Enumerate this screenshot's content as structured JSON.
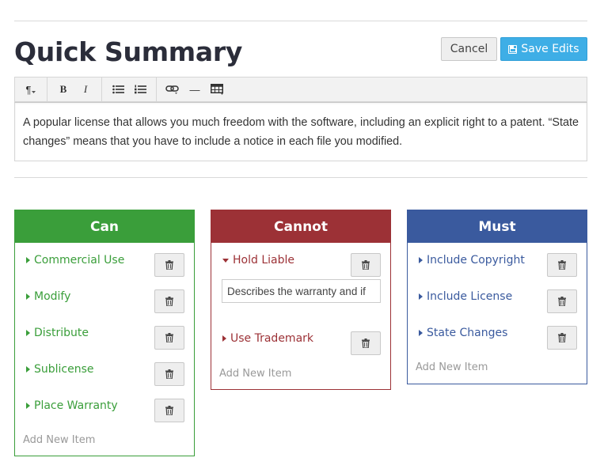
{
  "page": {
    "title": "Quick Summary",
    "cancel_label": "Cancel",
    "save_label": "Save Edits"
  },
  "toolbar": {
    "buttons": [
      {
        "name": "paragraph-format",
        "glyph": "¶"
      },
      {
        "name": "bold",
        "glyph": "B"
      },
      {
        "name": "italic",
        "glyph": "I"
      },
      {
        "name": "unordered-list",
        "icon": "bullet-list-icon"
      },
      {
        "name": "ordered-list",
        "icon": "numbered-list-icon"
      },
      {
        "name": "link",
        "icon": "link-icon"
      },
      {
        "name": "horizontal-rule",
        "glyph": "—"
      },
      {
        "name": "table",
        "icon": "table-icon"
      }
    ]
  },
  "editor": {
    "text": "A popular license that allows you much freedom with the software, including an explicit right to a patent. “State changes” means that you have to include a notice in each file you modified."
  },
  "columns": {
    "can": {
      "title": "Can",
      "color": "#3a9e3a",
      "items": [
        "Commercial Use",
        "Modify",
        "Distribute",
        "Sublicense",
        "Place Warranty"
      ],
      "add_label": "Add New Item"
    },
    "cannot": {
      "title": "Cannot",
      "color": "#9c3136",
      "items": [
        "Hold Liable",
        "Use Trademark"
      ],
      "expanded_item": "Hold Liable",
      "description_value": "Describes the warranty and if",
      "add_label": "Add New Item"
    },
    "must": {
      "title": "Must",
      "color": "#3a5a9e",
      "items": [
        "Include Copyright",
        "Include License",
        "State Changes"
      ],
      "add_label": "Add New Item"
    }
  },
  "colors": {
    "save_button": "#3eaee6",
    "title_text": "#2b2d3a"
  }
}
